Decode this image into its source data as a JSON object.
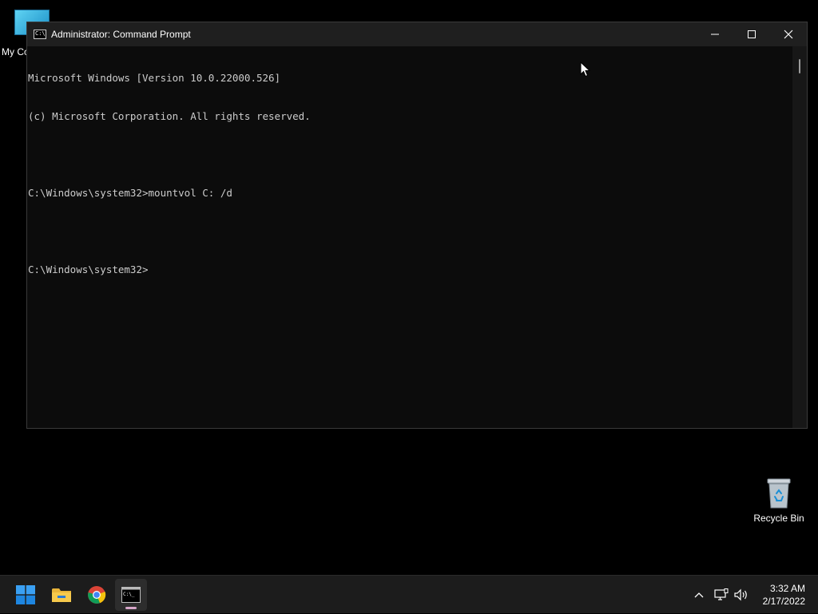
{
  "desktop": {
    "icons": [
      {
        "label": "My Co"
      },
      {
        "label": "Recycle Bin"
      }
    ]
  },
  "window": {
    "title": "Administrator: Command Prompt",
    "icon": "cmd-icon",
    "icon_glyph": "C:\\",
    "controls": [
      "minimize-icon",
      "maximize-icon",
      "close-icon"
    ]
  },
  "console": {
    "lines": [
      "Microsoft Windows [Version 10.0.22000.526]",
      "(c) Microsoft Corporation. All rights reserved.",
      "",
      "C:\\Windows\\system32>mountvol C: /d",
      "",
      "C:\\Windows\\system32>"
    ]
  },
  "taskbar": {
    "apps": [
      {
        "name": "start",
        "icon": "windows-logo-icon"
      },
      {
        "name": "file-explorer",
        "icon": "folder-icon"
      },
      {
        "name": "chrome",
        "icon": "chrome-icon"
      },
      {
        "name": "command-prompt",
        "icon": "cmd-icon",
        "active": true
      }
    ],
    "tray": {
      "icons": [
        "chevron-up-icon",
        "network-icon",
        "volume-icon"
      ],
      "time": "3:32 AM",
      "date": "2/17/2022"
    }
  },
  "colors": {
    "console_bg": "#0c0c0c",
    "console_text": "#cccccc",
    "titlebar_bg": "#1f1f1f",
    "taskbar_bg": "#1c1c1c",
    "accent": "#0078d4"
  }
}
